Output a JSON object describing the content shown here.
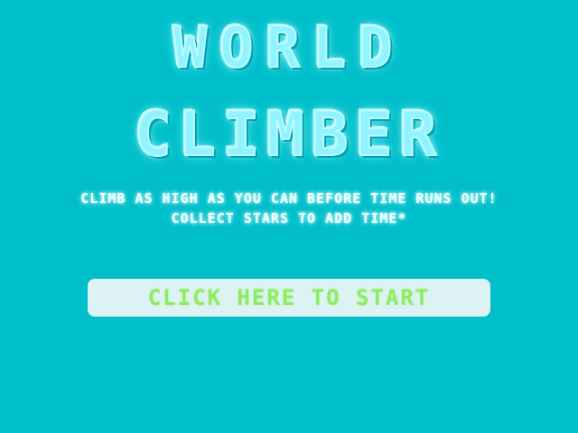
{
  "title": {
    "line1": "WORLD",
    "line2": "CLiMBER"
  },
  "subtitle": {
    "line1": "CLIMB AS HIGH AS YOU CAN BEFORE TIME RUNS OUT!",
    "line2": "COLLECT STARS TO ADD TIME*"
  },
  "start_button": {
    "label": "CLiCK HERE TO START"
  },
  "colors": {
    "background": "#00BFCA",
    "title": "#8FF4FF",
    "subtitle": "#F2FFFF",
    "button_background": "#DDF2F2",
    "button_text": "#8EEB66"
  }
}
